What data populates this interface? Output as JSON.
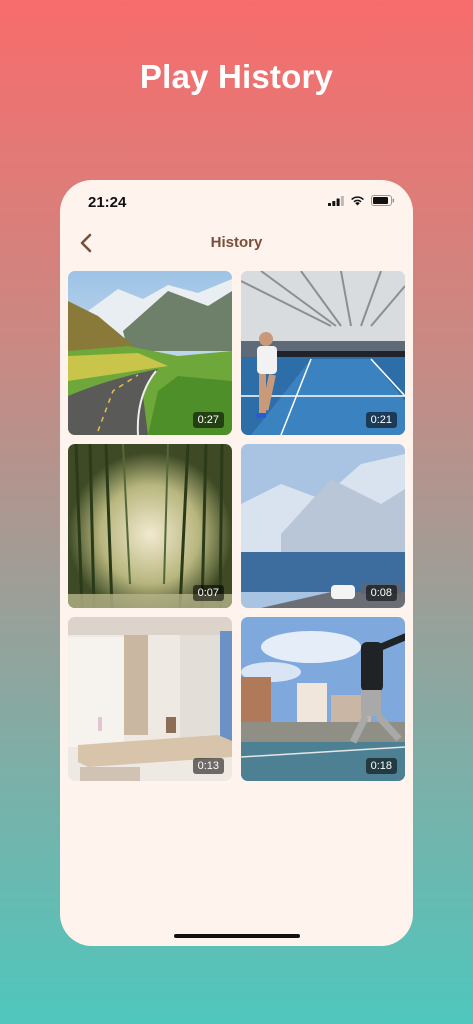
{
  "promo": {
    "title": "Play History"
  },
  "status_bar": {
    "time": "21:24"
  },
  "nav": {
    "title": "History"
  },
  "videos": [
    {
      "duration": "0:27",
      "subject": "mountain-road"
    },
    {
      "duration": "0:21",
      "subject": "indoor-tennis"
    },
    {
      "duration": "0:07",
      "subject": "bamboo-forest"
    },
    {
      "duration": "0:08",
      "subject": "snowy-lake-road"
    },
    {
      "duration": "0:13",
      "subject": "interior-room"
    },
    {
      "duration": "0:18",
      "subject": "outdoor-tennis"
    }
  ],
  "colors": {
    "gradient_top": "#f76c6c",
    "gradient_bottom": "#4fc7bd",
    "card_bg": "#fff3ee",
    "accent": "#7a4e3a"
  }
}
